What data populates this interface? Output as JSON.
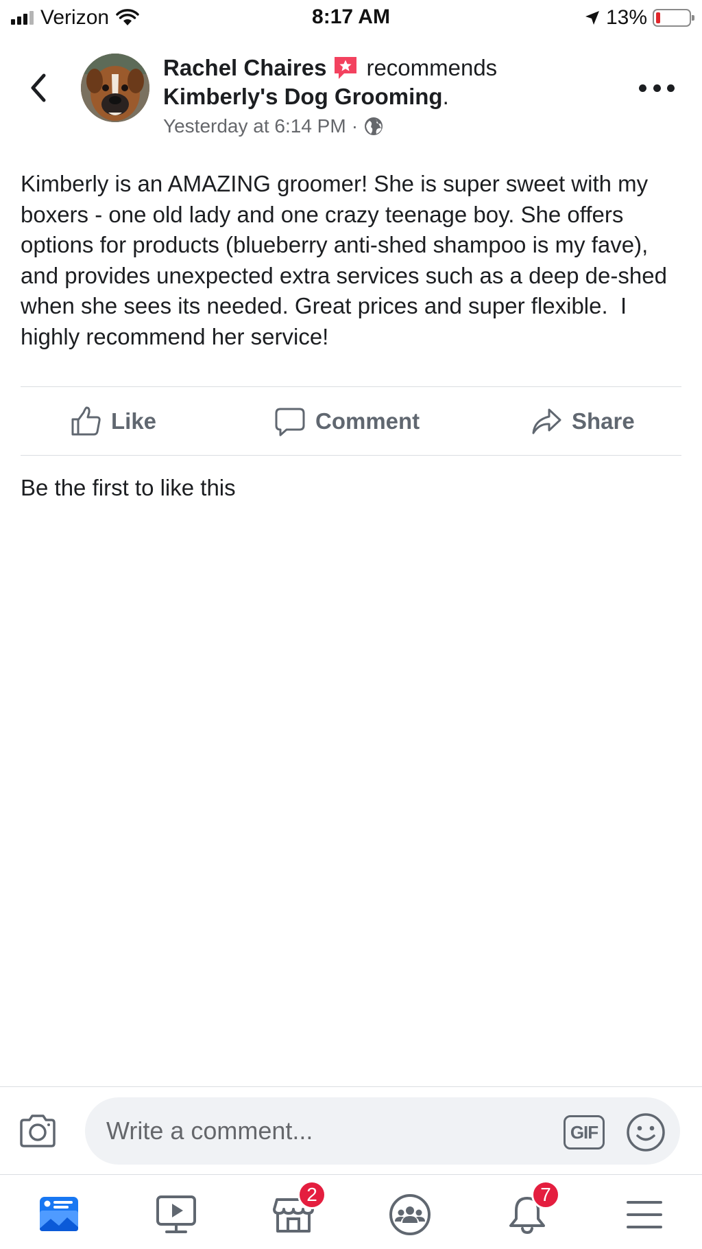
{
  "status_bar": {
    "carrier": "Verizon",
    "time": "8:17 AM",
    "battery_percent": "13%",
    "battery_level": 0.13,
    "signal_bars_filled": 3
  },
  "post": {
    "author": "Rachel Chaires",
    "action_text": "recommends",
    "page_name": "Kimberly's Dog Grooming",
    "page_suffix": ".",
    "timestamp": "Yesterday at 6:14 PM",
    "meta_separator": "·",
    "privacy_icon": "globe-icon",
    "body": "Kimberly is an AMAZING groomer! She is super sweet with my boxers - one old lady and one crazy teenage boy. She offers options for products (blueberry anti-shed shampoo is my fave), and provides unexpected extra services such as a deep de-shed when she sees its needed. Great prices and super flexible.  I highly recommend her service!",
    "reaction_summary": "Be the first to like this"
  },
  "actions": {
    "like": "Like",
    "comment": "Comment",
    "share": "Share"
  },
  "composer": {
    "placeholder": "Write a comment...",
    "gif_label": "GIF"
  },
  "tab_bar": {
    "items": [
      {
        "name": "news-feed",
        "icon": "news-feed-icon",
        "active": true
      },
      {
        "name": "watch",
        "icon": "video-play-icon"
      },
      {
        "name": "marketplace",
        "icon": "marketplace-icon",
        "badge": "2"
      },
      {
        "name": "groups",
        "icon": "groups-icon"
      },
      {
        "name": "notifications",
        "icon": "bell-icon",
        "badge": "7"
      },
      {
        "name": "menu",
        "icon": "hamburger-menu-icon"
      }
    ]
  },
  "colors": {
    "text_primary": "#1c1e21",
    "text_secondary": "#65676b",
    "icon_gray": "#606770",
    "divider": "#dadde1",
    "input_bg": "#f0f2f5",
    "badge_red": "#e41e3f",
    "brand_blue": "#1877f2",
    "recommend_pink": "#f3425f"
  }
}
